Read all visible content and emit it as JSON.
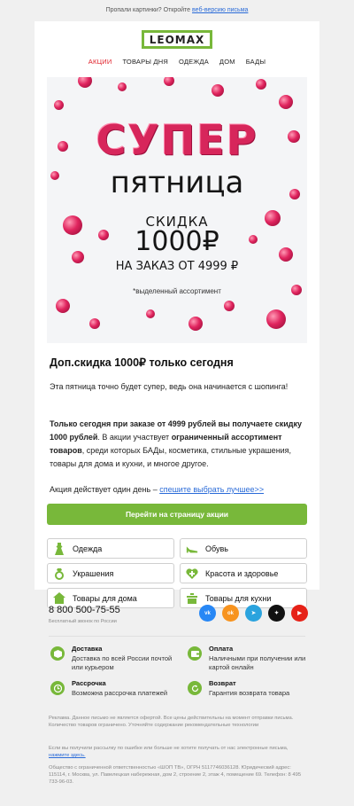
{
  "preheader": {
    "text": "Пропали картинки? Откройте",
    "link": "веб-версию письма"
  },
  "brand": {
    "logo": "LEOMAX",
    "accent": "#78b83a"
  },
  "nav": [
    {
      "label": "АКЦИИ",
      "active": true
    },
    {
      "label": "ТОВАРЫ ДНЯ",
      "active": false
    },
    {
      "label": "ОДЕЖДА",
      "active": false
    },
    {
      "label": "ДОМ",
      "active": false
    },
    {
      "label": "БАДЫ",
      "active": false
    }
  ],
  "hero": {
    "title": "СУПЕР",
    "subtitle": "пятница",
    "discount_label": "СКИДКА",
    "amount": "1000₽",
    "condition": "НА ЗАКАЗ ОТ 4999 ₽",
    "note": "*выделенный ассортимент"
  },
  "article": {
    "headline": "Доп.скидка 1000₽ только сегодня",
    "p1": "Эта пятница точно будет супер, ведь она начинается с шопинга!",
    "p2_bold1": "Только сегодня при заказе от 4999 рублей вы получаете скидку 1000 рублей",
    "p2_text1": ". В акции участвует ",
    "p2_bold2": "ограниченный ассортимент товаров",
    "p2_text2": ", среди которых БАДы, косметика, стильные украшения, товары для дома и кухни, и многое другое.",
    "p3_text": "Акция действует один день – ",
    "p3_link": "спешите выбрать лучшее>>"
  },
  "cta": {
    "label": "Перейти на страницу акции"
  },
  "categories": [
    {
      "label": "Одежда",
      "icon": "dress-icon"
    },
    {
      "label": "Обувь",
      "icon": "shoe-icon"
    },
    {
      "label": "Украшения",
      "icon": "ring-icon"
    },
    {
      "label": "Красота и здоровье",
      "icon": "health-icon"
    },
    {
      "label": "Товары для дома",
      "icon": "house-icon"
    },
    {
      "label": "Товары для кухни",
      "icon": "pot-icon"
    }
  ],
  "contact": {
    "phone": "8 800 500-75-55",
    "phone_note": "Бесплатный звонок по России"
  },
  "socials": [
    {
      "name": "vk-icon",
      "glyph": "vk",
      "color": "#2787f5"
    },
    {
      "name": "ok-icon",
      "glyph": "ok",
      "color": "#f7931e"
    },
    {
      "name": "telegram-icon",
      "glyph": "➤",
      "color": "#2aa3de"
    },
    {
      "name": "zen-icon",
      "glyph": "✦",
      "color": "#111111"
    },
    {
      "name": "youtube-icon",
      "glyph": "▶",
      "color": "#e62117"
    }
  ],
  "info": [
    {
      "title": "Доставка",
      "desc": "Доставка по всей России почтой или курьером",
      "icon": "box-icon"
    },
    {
      "title": "Оплата",
      "desc": "Наличными при получении или картой онлайн",
      "icon": "wallet-icon"
    },
    {
      "title": "Рассрочка",
      "desc": "Возможна рассрочка платежей",
      "icon": "clock-icon"
    },
    {
      "title": "Возврат",
      "desc": "Гарантия возврата товара",
      "icon": "return-icon"
    }
  ],
  "footer": {
    "disclaimer": "Реклама. Данное письмо не является офертой. Все цены действительны на момент отправки письма. Количество товаров ограничено. Уточняйте содержание рекомендательные технологии",
    "unsub_text": "Если вы получили рассылку по ошибке или больше не хотите получать от нас электронные письма,",
    "unsub_link": "нажмите здесь.",
    "legal": "Общество с ограниченной ответственностью «ШОП ТВ», ОГРН 5117746036128. Юридический адрес: 115114, г. Москва, ул. Павелецкая набережная, дом 2, строение 2, этаж 4, помещение 69. Телефон: 8 495 733-96-03."
  }
}
